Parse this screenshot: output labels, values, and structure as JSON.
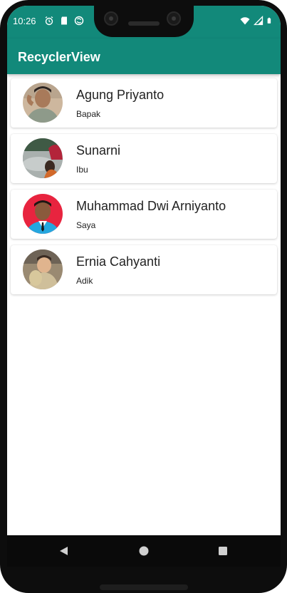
{
  "status_bar": {
    "time": "10:26",
    "icons_left": [
      "alarm-icon",
      "sd-card-icon",
      "sync-icon"
    ],
    "icons_right": [
      "wifi-icon",
      "signal-icon",
      "battery-icon"
    ]
  },
  "app_bar": {
    "title": "RecyclerView"
  },
  "contacts": [
    {
      "name": "Agung Priyanto",
      "relation": "Bapak",
      "avatar": "person-photo"
    },
    {
      "name": "Sunarni",
      "relation": "Ibu",
      "avatar": "person-photo"
    },
    {
      "name": "Muhammad Dwi Arniyanto",
      "relation": "Saya",
      "avatar": "person-photo"
    },
    {
      "name": "Ernia Cahyanti",
      "relation": "Adik",
      "avatar": "person-photo"
    }
  ],
  "nav_bar": {
    "buttons": [
      "back-icon",
      "home-icon",
      "recents-icon"
    ]
  },
  "colors": {
    "primary": "#12897a",
    "on_primary": "#ffffff",
    "text": "#222222",
    "background": "#ffffff",
    "frame": "#0d0d0d"
  }
}
